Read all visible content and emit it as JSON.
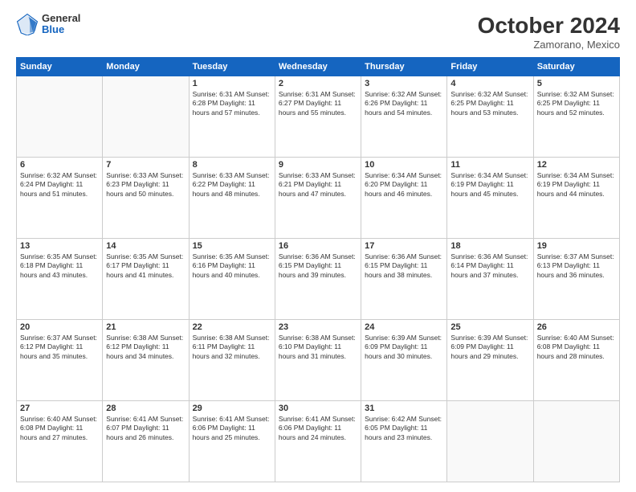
{
  "logo": {
    "general": "General",
    "blue": "Blue"
  },
  "title": "October 2024",
  "location": "Zamorano, Mexico",
  "days_of_week": [
    "Sunday",
    "Monday",
    "Tuesday",
    "Wednesday",
    "Thursday",
    "Friday",
    "Saturday"
  ],
  "weeks": [
    [
      {
        "day": "",
        "info": ""
      },
      {
        "day": "",
        "info": ""
      },
      {
        "day": "1",
        "info": "Sunrise: 6:31 AM\nSunset: 6:28 PM\nDaylight: 11 hours and 57 minutes."
      },
      {
        "day": "2",
        "info": "Sunrise: 6:31 AM\nSunset: 6:27 PM\nDaylight: 11 hours and 55 minutes."
      },
      {
        "day": "3",
        "info": "Sunrise: 6:32 AM\nSunset: 6:26 PM\nDaylight: 11 hours and 54 minutes."
      },
      {
        "day": "4",
        "info": "Sunrise: 6:32 AM\nSunset: 6:25 PM\nDaylight: 11 hours and 53 minutes."
      },
      {
        "day": "5",
        "info": "Sunrise: 6:32 AM\nSunset: 6:25 PM\nDaylight: 11 hours and 52 minutes."
      }
    ],
    [
      {
        "day": "6",
        "info": "Sunrise: 6:32 AM\nSunset: 6:24 PM\nDaylight: 11 hours and 51 minutes."
      },
      {
        "day": "7",
        "info": "Sunrise: 6:33 AM\nSunset: 6:23 PM\nDaylight: 11 hours and 50 minutes."
      },
      {
        "day": "8",
        "info": "Sunrise: 6:33 AM\nSunset: 6:22 PM\nDaylight: 11 hours and 48 minutes."
      },
      {
        "day": "9",
        "info": "Sunrise: 6:33 AM\nSunset: 6:21 PM\nDaylight: 11 hours and 47 minutes."
      },
      {
        "day": "10",
        "info": "Sunrise: 6:34 AM\nSunset: 6:20 PM\nDaylight: 11 hours and 46 minutes."
      },
      {
        "day": "11",
        "info": "Sunrise: 6:34 AM\nSunset: 6:19 PM\nDaylight: 11 hours and 45 minutes."
      },
      {
        "day": "12",
        "info": "Sunrise: 6:34 AM\nSunset: 6:19 PM\nDaylight: 11 hours and 44 minutes."
      }
    ],
    [
      {
        "day": "13",
        "info": "Sunrise: 6:35 AM\nSunset: 6:18 PM\nDaylight: 11 hours and 43 minutes."
      },
      {
        "day": "14",
        "info": "Sunrise: 6:35 AM\nSunset: 6:17 PM\nDaylight: 11 hours and 41 minutes."
      },
      {
        "day": "15",
        "info": "Sunrise: 6:35 AM\nSunset: 6:16 PM\nDaylight: 11 hours and 40 minutes."
      },
      {
        "day": "16",
        "info": "Sunrise: 6:36 AM\nSunset: 6:15 PM\nDaylight: 11 hours and 39 minutes."
      },
      {
        "day": "17",
        "info": "Sunrise: 6:36 AM\nSunset: 6:15 PM\nDaylight: 11 hours and 38 minutes."
      },
      {
        "day": "18",
        "info": "Sunrise: 6:36 AM\nSunset: 6:14 PM\nDaylight: 11 hours and 37 minutes."
      },
      {
        "day": "19",
        "info": "Sunrise: 6:37 AM\nSunset: 6:13 PM\nDaylight: 11 hours and 36 minutes."
      }
    ],
    [
      {
        "day": "20",
        "info": "Sunrise: 6:37 AM\nSunset: 6:12 PM\nDaylight: 11 hours and 35 minutes."
      },
      {
        "day": "21",
        "info": "Sunrise: 6:38 AM\nSunset: 6:12 PM\nDaylight: 11 hours and 34 minutes."
      },
      {
        "day": "22",
        "info": "Sunrise: 6:38 AM\nSunset: 6:11 PM\nDaylight: 11 hours and 32 minutes."
      },
      {
        "day": "23",
        "info": "Sunrise: 6:38 AM\nSunset: 6:10 PM\nDaylight: 11 hours and 31 minutes."
      },
      {
        "day": "24",
        "info": "Sunrise: 6:39 AM\nSunset: 6:09 PM\nDaylight: 11 hours and 30 minutes."
      },
      {
        "day": "25",
        "info": "Sunrise: 6:39 AM\nSunset: 6:09 PM\nDaylight: 11 hours and 29 minutes."
      },
      {
        "day": "26",
        "info": "Sunrise: 6:40 AM\nSunset: 6:08 PM\nDaylight: 11 hours and 28 minutes."
      }
    ],
    [
      {
        "day": "27",
        "info": "Sunrise: 6:40 AM\nSunset: 6:08 PM\nDaylight: 11 hours and 27 minutes."
      },
      {
        "day": "28",
        "info": "Sunrise: 6:41 AM\nSunset: 6:07 PM\nDaylight: 11 hours and 26 minutes."
      },
      {
        "day": "29",
        "info": "Sunrise: 6:41 AM\nSunset: 6:06 PM\nDaylight: 11 hours and 25 minutes."
      },
      {
        "day": "30",
        "info": "Sunrise: 6:41 AM\nSunset: 6:06 PM\nDaylight: 11 hours and 24 minutes."
      },
      {
        "day": "31",
        "info": "Sunrise: 6:42 AM\nSunset: 6:05 PM\nDaylight: 11 hours and 23 minutes."
      },
      {
        "day": "",
        "info": ""
      },
      {
        "day": "",
        "info": ""
      }
    ]
  ]
}
